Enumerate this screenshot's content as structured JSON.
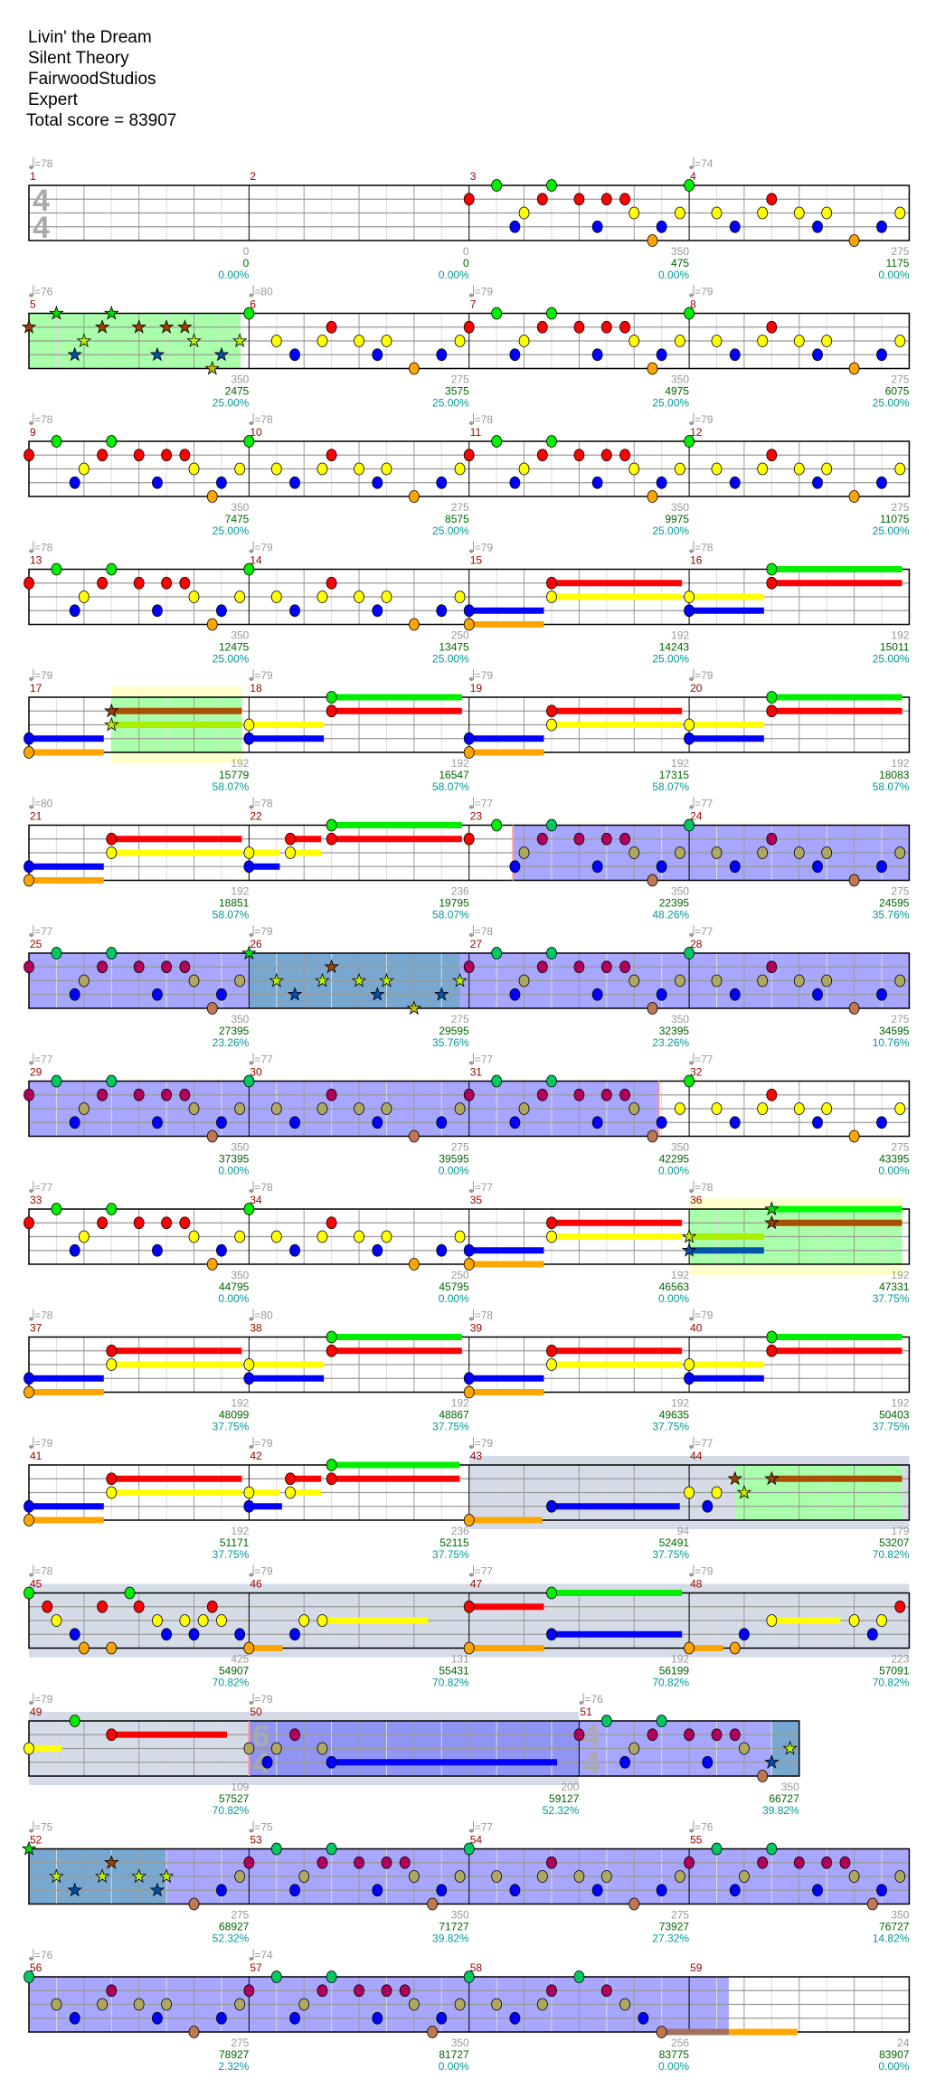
{
  "song": {
    "title": "Livin' the Dream",
    "artist": "Silent Theory",
    "charter": "FairwoodStudios",
    "difficulty": "Expert",
    "total_score": "Total score = 83907"
  },
  "colors": {
    "lanes": [
      "#00ee00",
      "#ff0000",
      "#ffff00",
      "#0000ff",
      "#ffa500"
    ],
    "lanes_overlay": [
      "#00c860",
      "#b0005a",
      "#b0a860",
      "#0000ff",
      "#c07850"
    ],
    "lanes_star": [
      "#00dd00",
      "#a04000",
      "#bbee00",
      "#0050b0",
      "#c0c000"
    ],
    "sustain_star": [
      "#00ff00",
      "#a85000",
      "#aaee00",
      "#0055aa",
      "#c0c000"
    ],
    "star_region": "#aaffaa",
    "phrase_region": "#ffffcc",
    "gray_region": "#d5dce8",
    "activation_overlay": "rgba(60,60,255,0.45)",
    "activation_edge": "#ff9999"
  },
  "patterns": {
    "A": [
      [
        0,
        1
      ],
      [
        0.5,
        0
      ],
      [
        0.833,
        3
      ],
      [
        1,
        2
      ],
      [
        1.333,
        1
      ],
      [
        1.5,
        0
      ],
      [
        2,
        1
      ],
      [
        2.333,
        3
      ],
      [
        2.5,
        1
      ],
      [
        2.833,
        1
      ],
      [
        3,
        2
      ],
      [
        3.333,
        4
      ],
      [
        3.5,
        3
      ],
      [
        3.833,
        2
      ]
    ],
    "B": [
      [
        0,
        0
      ],
      [
        0.5,
        2
      ],
      [
        0.833,
        3
      ],
      [
        1.333,
        2
      ],
      [
        1.5,
        1
      ],
      [
        2,
        2
      ],
      [
        2.333,
        3
      ],
      [
        2.5,
        2
      ],
      [
        3,
        4
      ],
      [
        3.5,
        3
      ],
      [
        3.833,
        2
      ]
    ],
    "C": [
      [
        0,
        3,
        1.36
      ],
      [
        0,
        4,
        1.36
      ],
      [
        1.5,
        1,
        2.37
      ],
      [
        1.5,
        2,
        2.37
      ]
    ],
    "D": [
      [
        0,
        2,
        1.36
      ],
      [
        0,
        3,
        1.36
      ],
      [
        1.5,
        0,
        2.37
      ],
      [
        1.5,
        1,
        2.37
      ]
    ]
  },
  "measures": [
    {
      "n": "1",
      "tempo": "=78",
      "ts": [
        "4",
        "4"
      ],
      "beats": 4,
      "pattern": null,
      "points": "0",
      "score": "0",
      "percent": "0.00%"
    },
    {
      "n": "2",
      "tempo": null,
      "beats": 4,
      "pattern": null,
      "points": "0",
      "score": "0",
      "percent": "0.00%"
    },
    {
      "n": "3",
      "tempo": null,
      "beats": 4,
      "pattern": "A",
      "points": "350",
      "score": "475",
      "percent": "0.00%"
    },
    {
      "n": "4",
      "tempo": "=74",
      "beats": 4,
      "pattern": "B",
      "points": "275",
      "score": "1175",
      "percent": "0.00%"
    },
    {
      "n": "5",
      "tempo": "=76",
      "beats": 4,
      "pattern": "A",
      "star": [
        0,
        4
      ],
      "points": "350",
      "score": "2475",
      "percent": "25.00%"
    },
    {
      "n": "6",
      "tempo": "=80",
      "beats": 4,
      "pattern": "B",
      "points": "275",
      "score": "3575",
      "percent": "25.00%"
    },
    {
      "n": "7",
      "tempo": "=79",
      "beats": 4,
      "pattern": "A",
      "points": "350",
      "score": "4975",
      "percent": "25.00%"
    },
    {
      "n": "8",
      "tempo": "=79",
      "beats": 4,
      "pattern": "B",
      "points": "275",
      "score": "6075",
      "percent": "25.00%"
    },
    {
      "n": "9",
      "tempo": "=78",
      "beats": 4,
      "pattern": "A",
      "points": "350",
      "score": "7475",
      "percent": "25.00%"
    },
    {
      "n": "10",
      "tempo": "=78",
      "beats": 4,
      "pattern": "B",
      "points": "275",
      "score": "8575",
      "percent": "25.00%"
    },
    {
      "n": "11",
      "tempo": "=78",
      "beats": 4,
      "pattern": "A",
      "points": "350",
      "score": "9975",
      "percent": "25.00%"
    },
    {
      "n": "12",
      "tempo": "=79",
      "beats": 4,
      "pattern": "B",
      "points": "275",
      "score": "11075",
      "percent": "25.00%"
    },
    {
      "n": "13",
      "tempo": "=78",
      "beats": 4,
      "pattern": "A",
      "points": "350",
      "score": "12475",
      "percent": "25.00%"
    },
    {
      "n": "14",
      "tempo": "=79",
      "beats": 4,
      "pattern": "B",
      "points": "250",
      "score": "13475",
      "percent": "25.00%"
    },
    {
      "n": "15",
      "tempo": "=79",
      "beats": 4,
      "pattern": "C",
      "points": "192",
      "score": "14243",
      "percent": "25.00%"
    },
    {
      "n": "16",
      "tempo": "=78",
      "beats": 4,
      "pattern": "D",
      "points": "192",
      "score": "15011",
      "percent": "25.00%"
    },
    {
      "n": "17",
      "tempo": "=79",
      "beats": 4,
      "pattern": "C",
      "star": [
        1.5,
        1.5
      ],
      "points": "192",
      "score": "15779",
      "percent": "58.07%"
    },
    {
      "n": "18",
      "tempo": "=79",
      "beats": 4,
      "pattern": "D",
      "points": "192",
      "score": "16547",
      "percent": "58.07%"
    },
    {
      "n": "19",
      "tempo": "=79",
      "beats": 4,
      "pattern": "C",
      "points": "192",
      "score": "17315",
      "percent": "58.07%"
    },
    {
      "n": "20",
      "tempo": "=79",
      "beats": 4,
      "pattern": "D",
      "points": "192",
      "score": "18083",
      "percent": "58.07%"
    },
    {
      "n": "21",
      "tempo": "=80",
      "beats": 4,
      "pattern": "C",
      "points": "192",
      "score": "18851",
      "percent": "58.07%"
    },
    {
      "n": "22",
      "tempo": "=78",
      "beats": 4,
      "notes": [
        [
          0,
          2,
          0.56
        ],
        [
          0,
          3,
          0.56
        ],
        [
          0.75,
          2,
          0.56
        ],
        [
          0.75,
          1,
          0.56
        ],
        [
          1.5,
          1,
          2.37
        ],
        [
          1.5,
          0,
          2.37
        ]
      ],
      "points": "236",
      "score": "19795",
      "percent": "58.07%"
    },
    {
      "n": "23",
      "tempo": "=77",
      "beats": 4,
      "pattern": "A",
      "points": "350",
      "score": "22395",
      "percent": "48.26%"
    },
    {
      "n": "24",
      "tempo": "=77",
      "beats": 4,
      "pattern": "B",
      "points": "275",
      "score": "24595",
      "percent": "35.76%"
    },
    {
      "n": "25",
      "tempo": "=77",
      "beats": 4,
      "pattern": "A",
      "points": "350",
      "score": "27395",
      "percent": "23.26%"
    },
    {
      "n": "26",
      "tempo": "=79",
      "beats": 4,
      "pattern": "B",
      "star": [
        0,
        4
      ],
      "points": "275",
      "score": "29595",
      "percent": "35.76%"
    },
    {
      "n": "27",
      "tempo": "=78",
      "beats": 4,
      "pattern": "A",
      "points": "350",
      "score": "32395",
      "percent": "23.26%"
    },
    {
      "n": "28",
      "tempo": "=77",
      "beats": 4,
      "pattern": "B",
      "points": "275",
      "score": "34595",
      "percent": "10.76%"
    },
    {
      "n": "29",
      "tempo": "=77",
      "beats": 4,
      "pattern": "A",
      "points": "350",
      "score": "37395",
      "percent": "0.00%"
    },
    {
      "n": "30",
      "tempo": "=77",
      "beats": 4,
      "pattern": "B",
      "points": "275",
      "score": "39595",
      "percent": "0.00%"
    },
    {
      "n": "31",
      "tempo": "=77",
      "beats": 4,
      "pattern": "A",
      "points": "350",
      "score": "42295",
      "percent": "0.00%"
    },
    {
      "n": "32",
      "tempo": "=77",
      "beats": 4,
      "pattern": "B",
      "points": "275",
      "score": "43395",
      "percent": "0.00%"
    },
    {
      "n": "33",
      "tempo": "=77",
      "beats": 4,
      "pattern": "A",
      "points": "350",
      "score": "44795",
      "percent": "0.00%"
    },
    {
      "n": "34",
      "tempo": "=78",
      "beats": 4,
      "pattern": "B",
      "points": "250",
      "score": "45795",
      "percent": "0.00%"
    },
    {
      "n": "35",
      "tempo": "=77",
      "beats": 4,
      "pattern": "C",
      "points": "192",
      "score": "46563",
      "percent": "0.00%"
    },
    {
      "n": "36",
      "tempo": "=78",
      "beats": 4,
      "pattern": "D",
      "star": [
        0,
        4
      ],
      "points": "192",
      "score": "47331",
      "percent": "37.75%"
    },
    {
      "n": "37",
      "tempo": "=78",
      "beats": 4,
      "pattern": "C",
      "points": "192",
      "score": "48099",
      "percent": "37.75%"
    },
    {
      "n": "38",
      "tempo": "=80",
      "beats": 4,
      "pattern": "D",
      "points": "192",
      "score": "48867",
      "percent": "37.75%"
    },
    {
      "n": "39",
      "tempo": "=78",
      "beats": 4,
      "pattern": "C",
      "points": "192",
      "score": "49635",
      "percent": "37.75%"
    },
    {
      "n": "40",
      "tempo": "=79",
      "beats": 4,
      "pattern": "D",
      "points": "192",
      "score": "50403",
      "percent": "37.75%"
    },
    {
      "n": "41",
      "tempo": "=79",
      "beats": 4,
      "pattern": "C",
      "points": "192",
      "score": "51171",
      "percent": "37.75%"
    },
    {
      "n": "42",
      "tempo": "=79",
      "beats": 4,
      "notes": [
        [
          0,
          2,
          0.56
        ],
        [
          0,
          3,
          0.6
        ],
        [
          0.75,
          2,
          0.56
        ],
        [
          0.75,
          1,
          0.56
        ],
        [
          1.5,
          1,
          2.33
        ],
        [
          1.5,
          0,
          2.33
        ]
      ],
      "points": "236",
      "score": "52115",
      "percent": "37.75%"
    },
    {
      "n": "43",
      "tempo": "=79",
      "beats": 4,
      "notes": [
        [
          0,
          4,
          1.33
        ],
        [
          1.5,
          3,
          2.33
        ]
      ],
      "points": "94",
      "score": "52491",
      "percent": "37.75%"
    },
    {
      "n": "44",
      "tempo": "=77",
      "beats": 4,
      "notes": [
        [
          0,
          2
        ],
        [
          0.333,
          3
        ],
        [
          0.5,
          2
        ],
        [
          0.833,
          1,
          0,
          1
        ],
        [
          1,
          2,
          0,
          1
        ],
        [
          1.5,
          1,
          2.37,
          1
        ]
      ],
      "points": "179",
      "score": "53207",
      "percent": "70.82%"
    },
    {
      "n": "45",
      "tempo": "=78",
      "beats": 4,
      "notes": [
        [
          0,
          0
        ],
        [
          0.333,
          1
        ],
        [
          0.5,
          2
        ],
        [
          0.833,
          3
        ],
        [
          1,
          4
        ],
        [
          1.333,
          1
        ],
        [
          1.5,
          4
        ],
        [
          1.833,
          0
        ],
        [
          2,
          1
        ],
        [
          2.333,
          2
        ],
        [
          2.5,
          3
        ],
        [
          2.833,
          2
        ],
        [
          3,
          3
        ],
        [
          3.167,
          2
        ],
        [
          3.333,
          1
        ],
        [
          3.5,
          2
        ],
        [
          3.833,
          3
        ]
      ],
      "points": "425",
      "score": "54907",
      "percent": "70.82%"
    },
    {
      "n": "46",
      "tempo": "=79",
      "beats": 4,
      "notes": [
        [
          0,
          4,
          0.61
        ],
        [
          0.833,
          3
        ],
        [
          1,
          2
        ],
        [
          1.333,
          2,
          1.92
        ]
      ],
      "points": "131",
      "score": "55431",
      "percent": "70.82%"
    },
    {
      "n": "47",
      "tempo": "=77",
      "beats": 4,
      "notes": [
        [
          0,
          1,
          1.36
        ],
        [
          0,
          4,
          1.36
        ],
        [
          1.5,
          0,
          2.37
        ],
        [
          1.5,
          3,
          2.37
        ]
      ],
      "points": "192",
      "score": "56199",
      "percent": "70.82%"
    },
    {
      "n": "48",
      "tempo": "=79",
      "beats": 4,
      "notes": [
        [
          0,
          4,
          0.62
        ],
        [
          0.833,
          4
        ],
        [
          1,
          3
        ],
        [
          1.5,
          2,
          1.25
        ],
        [
          3,
          2
        ],
        [
          3.333,
          3
        ],
        [
          3.5,
          2
        ],
        [
          3.833,
          1
        ]
      ],
      "points": "223",
      "score": "57091",
      "percent": "70.82%"
    },
    {
      "n": "49",
      "tempo": "=79",
      "beats": 4,
      "notes": [
        [
          0,
          2,
          0.6
        ],
        [
          0.833,
          0
        ],
        [
          1.5,
          1,
          2.1
        ]
      ],
      "points": "109",
      "score": "57527",
      "percent": "70.82%"
    },
    {
      "n": "50",
      "tempo": "=79",
      "ts": [
        "6",
        "4"
      ],
      "beats": 6,
      "notes": [
        [
          0,
          2
        ],
        [
          0.333,
          3
        ],
        [
          0.5,
          2
        ],
        [
          0.833,
          1
        ],
        [
          1.333,
          2
        ],
        [
          1.5,
          3,
          4.1
        ]
      ],
      "points": "200",
      "score": "59127",
      "percent": "52.32%"
    },
    {
      "n": "51",
      "tempo": "=76",
      "ts": [
        "4",
        "4"
      ],
      "beats": 4,
      "pattern": "A",
      "star": [
        3.5,
        4
      ],
      "points": "350",
      "score": "66727",
      "percent": "39.82%"
    },
    {
      "n": "52",
      "tempo": "=75",
      "beats": 4,
      "pattern": "B",
      "star": [
        0,
        2.5
      ],
      "points": "275",
      "score": "68927",
      "percent": "52.32%"
    },
    {
      "n": "53",
      "tempo": "=75",
      "beats": 4,
      "pattern": "A",
      "points": "350",
      "score": "71727",
      "percent": "39.82%"
    },
    {
      "n": "54",
      "tempo": "=77",
      "beats": 4,
      "pattern": "B",
      "points": "275",
      "score": "73927",
      "percent": "27.32%"
    },
    {
      "n": "55",
      "tempo": "=76",
      "beats": 4,
      "pattern": "A",
      "points": "350",
      "score": "76727",
      "percent": "14.82%"
    },
    {
      "n": "56",
      "tempo": "=76",
      "beats": 4,
      "pattern": "B",
      "points": "275",
      "score": "78927",
      "percent": "2.32%"
    },
    {
      "n": "57",
      "tempo": "=74",
      "beats": 4,
      "pattern": "A",
      "points": "350",
      "score": "81727",
      "percent": "0.00%"
    },
    {
      "n": "58",
      "tempo": null,
      "beats": 4,
      "notes": [
        [
          0,
          0
        ],
        [
          0.5,
          2
        ],
        [
          0.833,
          3
        ],
        [
          1.333,
          2
        ],
        [
          1.5,
          1
        ],
        [
          2,
          0
        ],
        [
          2.5,
          1
        ],
        [
          2.833,
          2
        ],
        [
          3.167,
          3
        ],
        [
          3.5,
          4,
          2.47
        ]
      ],
      "points": "256",
      "score": "83775",
      "percent": "0.00%"
    },
    {
      "n": "59",
      "tempo": null,
      "beats": 4,
      "notes": [],
      "points": "24",
      "score": "83907",
      "percent": "0.00%"
    }
  ],
  "regions": {
    "gray": [
      {
        "from": [
          "43",
          0
        ],
        "to": [
          "50",
          6
        ]
      }
    ],
    "phrase": [
      {
        "from": [
          "17",
          1.5
        ],
        "to": [
          "17",
          3.87
        ]
      },
      {
        "from": [
          "36",
          0
        ],
        "to": [
          "36",
          3.87
        ]
      }
    ],
    "star": [
      {
        "from": [
          "5",
          0
        ],
        "to": [
          "5",
          3.85
        ]
      },
      {
        "from": [
          "17",
          1.5
        ],
        "to": [
          "17",
          3.87
        ]
      },
      {
        "from": [
          "26",
          0
        ],
        "to": [
          "26",
          3.83
        ]
      },
      {
        "from": [
          "36",
          0
        ],
        "to": [
          "36",
          3.87
        ]
      },
      {
        "from": [
          "44",
          0.833
        ],
        "to": [
          "44",
          3.87
        ]
      },
      {
        "from": [
          "51",
          3.5
        ],
        "to": [
          "51",
          4
        ]
      },
      {
        "from": [
          "52",
          0
        ],
        "to": [
          "52",
          2.5
        ]
      }
    ],
    "activation": [
      {
        "from": [
          "23",
          0.8
        ],
        "to": [
          "31",
          3.45
        ]
      },
      {
        "from": [
          "50",
          0
        ],
        "to": [
          "59",
          0.72
        ]
      }
    ]
  }
}
